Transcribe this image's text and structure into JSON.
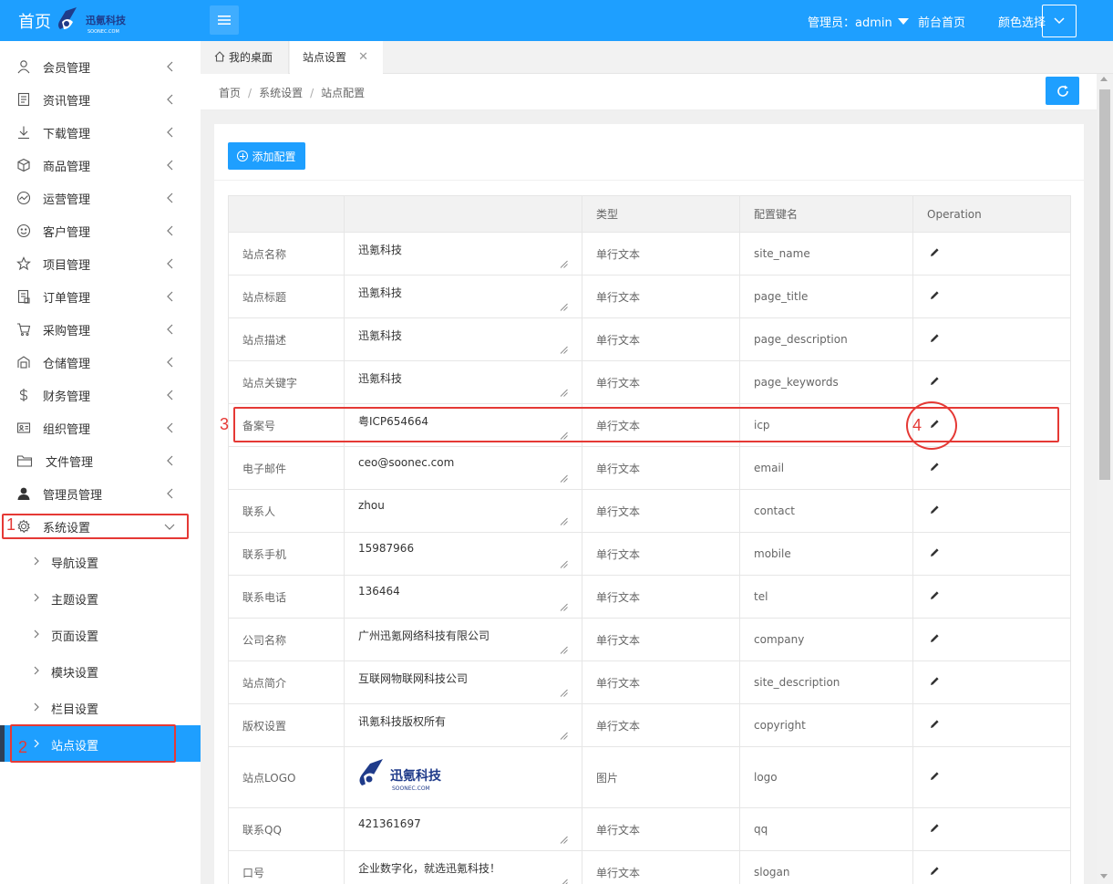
{
  "header": {
    "home_title": "首页",
    "admin_label": "管理员：admin",
    "front_home": "前台首页",
    "color_select": "颜色选择",
    "logo_cn": "迅氪科技",
    "logo_en": "SOONEC.COM"
  },
  "sidebar": {
    "items": [
      {
        "label": "会员管理",
        "icon": "user-icon"
      },
      {
        "label": "资讯管理",
        "icon": "document-icon"
      },
      {
        "label": "下载管理",
        "icon": "download-icon"
      },
      {
        "label": "商品管理",
        "icon": "box-icon"
      },
      {
        "label": "运营管理",
        "icon": "chart-icon"
      },
      {
        "label": "客户管理",
        "icon": "smile-icon"
      },
      {
        "label": "项目管理",
        "icon": "star-icon"
      },
      {
        "label": "订单管理",
        "icon": "order-icon"
      },
      {
        "label": "采购管理",
        "icon": "cart-icon"
      },
      {
        "label": "仓储管理",
        "icon": "warehouse-icon"
      },
      {
        "label": "财务管理",
        "icon": "dollar-icon"
      },
      {
        "label": "组织管理",
        "icon": "id-card-icon"
      },
      {
        "label": "文件管理",
        "icon": "folder-icon"
      },
      {
        "label": "管理员管理",
        "icon": "person-icon"
      },
      {
        "label": "系统设置",
        "icon": "gear-icon"
      }
    ],
    "sub_items": [
      {
        "label": "导航设置"
      },
      {
        "label": "主题设置"
      },
      {
        "label": "页面设置"
      },
      {
        "label": "模块设置"
      },
      {
        "label": "栏目设置"
      },
      {
        "label": "站点设置"
      }
    ]
  },
  "tabs": [
    {
      "label": "我的桌面"
    },
    {
      "label": "站点设置"
    }
  ],
  "breadcrumb": {
    "home": "首页",
    "level2": "系统设置",
    "level3": "站点配置",
    "sep": "/"
  },
  "toolbar": {
    "add_label": "添加配置"
  },
  "table": {
    "headers": [
      "",
      "",
      "类型",
      "配置键名",
      "Operation"
    ],
    "rows": [
      {
        "name": "站点名称",
        "value": "迅氪科技",
        "type": "单行文本",
        "key": "site_name"
      },
      {
        "name": "站点标题",
        "value": "迅氪科技",
        "type": "单行文本",
        "key": "page_title"
      },
      {
        "name": "站点描述",
        "value": "迅氪科技",
        "type": "单行文本",
        "key": "page_description"
      },
      {
        "name": "站点关键字",
        "value": "迅氪科技",
        "type": "单行文本",
        "key": "page_keywords"
      },
      {
        "name": "备案号",
        "value": "粤ICP654664",
        "type": "单行文本",
        "key": "icp"
      },
      {
        "name": "电子邮件",
        "value": "ceo@soonec.com",
        "type": "单行文本",
        "key": "email"
      },
      {
        "name": "联系人",
        "value": "zhou",
        "type": "单行文本",
        "key": "contact"
      },
      {
        "name": "联系手机",
        "value": "15987966",
        "type": "单行文本",
        "key": "mobile"
      },
      {
        "name": "联系电话",
        "value": "136464",
        "type": "单行文本",
        "key": "tel"
      },
      {
        "name": "公司名称",
        "value": "广州迅氪网络科技有限公司",
        "type": "单行文本",
        "key": "company"
      },
      {
        "name": "站点简介",
        "value": "互联网物联网科技公司",
        "type": "单行文本",
        "key": "site_description"
      },
      {
        "name": "版权设置",
        "value": "讯氪科技版权所有",
        "type": "单行文本",
        "key": "copyright"
      },
      {
        "name": "站点LOGO",
        "value": "",
        "type": "图片",
        "key": "logo"
      },
      {
        "name": "联系QQ",
        "value": "421361697",
        "type": "单行文本",
        "key": "qq"
      },
      {
        "name": "口号",
        "value": "企业数字化，就选迅氪科技！",
        "type": "单行文本",
        "key": "slogan"
      }
    ]
  },
  "annotations": [
    "1",
    "2",
    "3",
    "4"
  ],
  "colors": {
    "primary": "#1E9FFF",
    "annotation": "#e53935"
  }
}
